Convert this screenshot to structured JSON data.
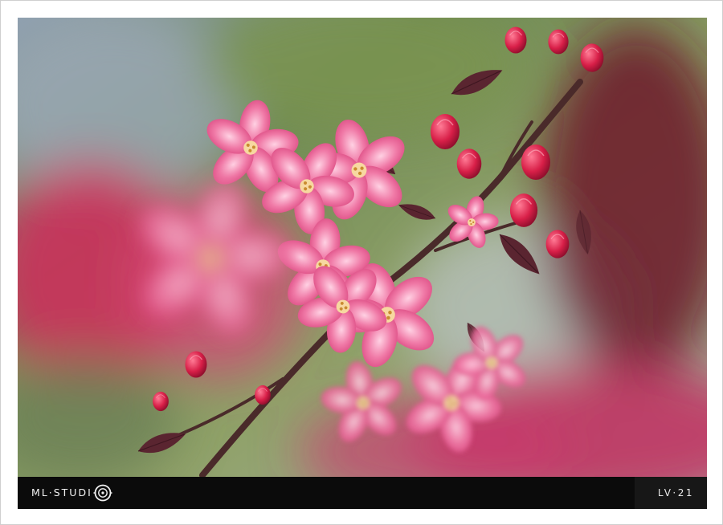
{
  "footer": {
    "brand_text": "ML·STUDI",
    "brand_mark_icon": "camera-lens-o-icon",
    "code": "LV·21"
  },
  "colors": {
    "frame": "#ffffff",
    "footer_bar": "#0b0b0b",
    "footer_panel": "#171717",
    "blossom_pink": "#ec5f97",
    "bud_red": "#d81f48",
    "leaf_maroon": "#5a2530",
    "background_green": "#8c9d6c"
  }
}
